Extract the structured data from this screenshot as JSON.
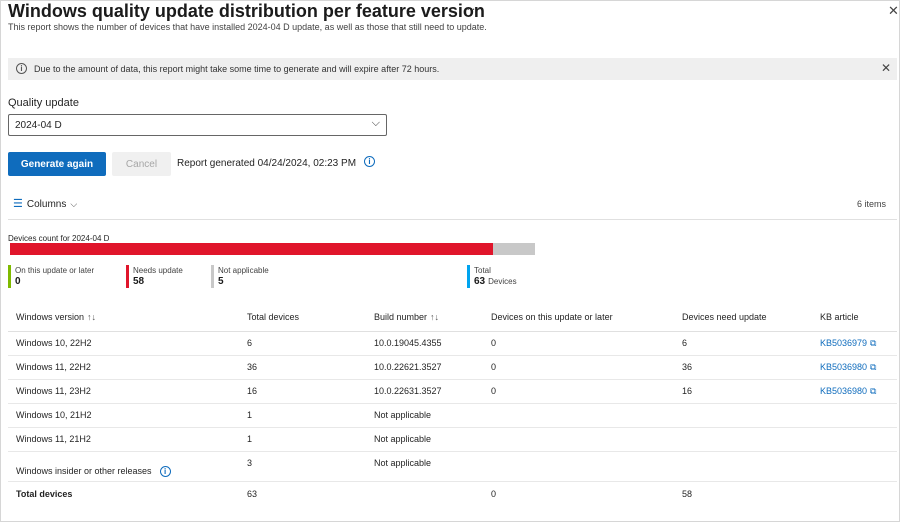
{
  "header": {
    "title": "Windows quality update distribution per feature version",
    "more_glyph": "···",
    "subtitle": "This report shows the number of devices that have installed 2024-04 D update, as well as those that still need to update.",
    "close_glyph": "✕"
  },
  "banner": {
    "text": "Due to the amount of data, this report might take some time to generate and will expire after 72 hours.",
    "close_glyph": "✕"
  },
  "quality_update": {
    "label": "Quality update",
    "value": "2024-04 D"
  },
  "actions": {
    "generate_label": "Generate again",
    "cancel_label": "Cancel",
    "report_generated": "Report generated 04/24/2024, 02:23 PM"
  },
  "toolbar": {
    "columns_label": "Columns",
    "items_count": "6 items"
  },
  "summary": {
    "bar_title": "Devices count for 2024-04 D",
    "bar_fraction_needs_update": 0.9206,
    "legend": [
      {
        "label": "On this update or later",
        "value": "0",
        "color": "#7fba00"
      },
      {
        "label": "Needs update",
        "value": "58",
        "color": "#e0152b"
      },
      {
        "label": "Not applicable",
        "value": "5",
        "color": "#c8c8c8"
      },
      {
        "label": "Total",
        "value": "63",
        "unit": "Devices",
        "color": "#00a4ef"
      }
    ]
  },
  "table": {
    "headers": [
      "Windows version",
      "Total devices",
      "Build number",
      "Devices on this update or later",
      "Devices need update",
      "KB article"
    ],
    "rows": [
      {
        "version": "Windows 10, 22H2",
        "total": "6",
        "build": "10.0.19045.4355",
        "on_update": "0",
        "need_update": "6",
        "kb": "KB5036979"
      },
      {
        "version": "Windows 11, 22H2",
        "total": "36",
        "build": "10.0.22621.3527",
        "on_update": "0",
        "need_update": "36",
        "kb": "KB5036980"
      },
      {
        "version": "Windows 11, 23H2",
        "total": "16",
        "build": "10.0.22631.3527",
        "on_update": "0",
        "need_update": "16",
        "kb": "KB5036980"
      },
      {
        "version": "Windows 10, 21H2",
        "total": "1",
        "build": "Not applicable",
        "on_update": "",
        "need_update": "",
        "kb": ""
      },
      {
        "version": "Windows 11, 21H2",
        "total": "1",
        "build": "Not applicable",
        "on_update": "",
        "need_update": "",
        "kb": ""
      },
      {
        "version": "Windows insider or other releases",
        "total": "3",
        "build": "Not applicable",
        "on_update": "",
        "need_update": "",
        "kb": ""
      }
    ],
    "total_row": {
      "label": "Total devices",
      "total": "63",
      "on_update": "0",
      "need_update": "58"
    }
  },
  "colors": {
    "accent": "#0f6cbd",
    "needs_update": "#e0152b",
    "on_update": "#7fba00",
    "not_applicable": "#c8c8c8",
    "total": "#00a4ef"
  }
}
